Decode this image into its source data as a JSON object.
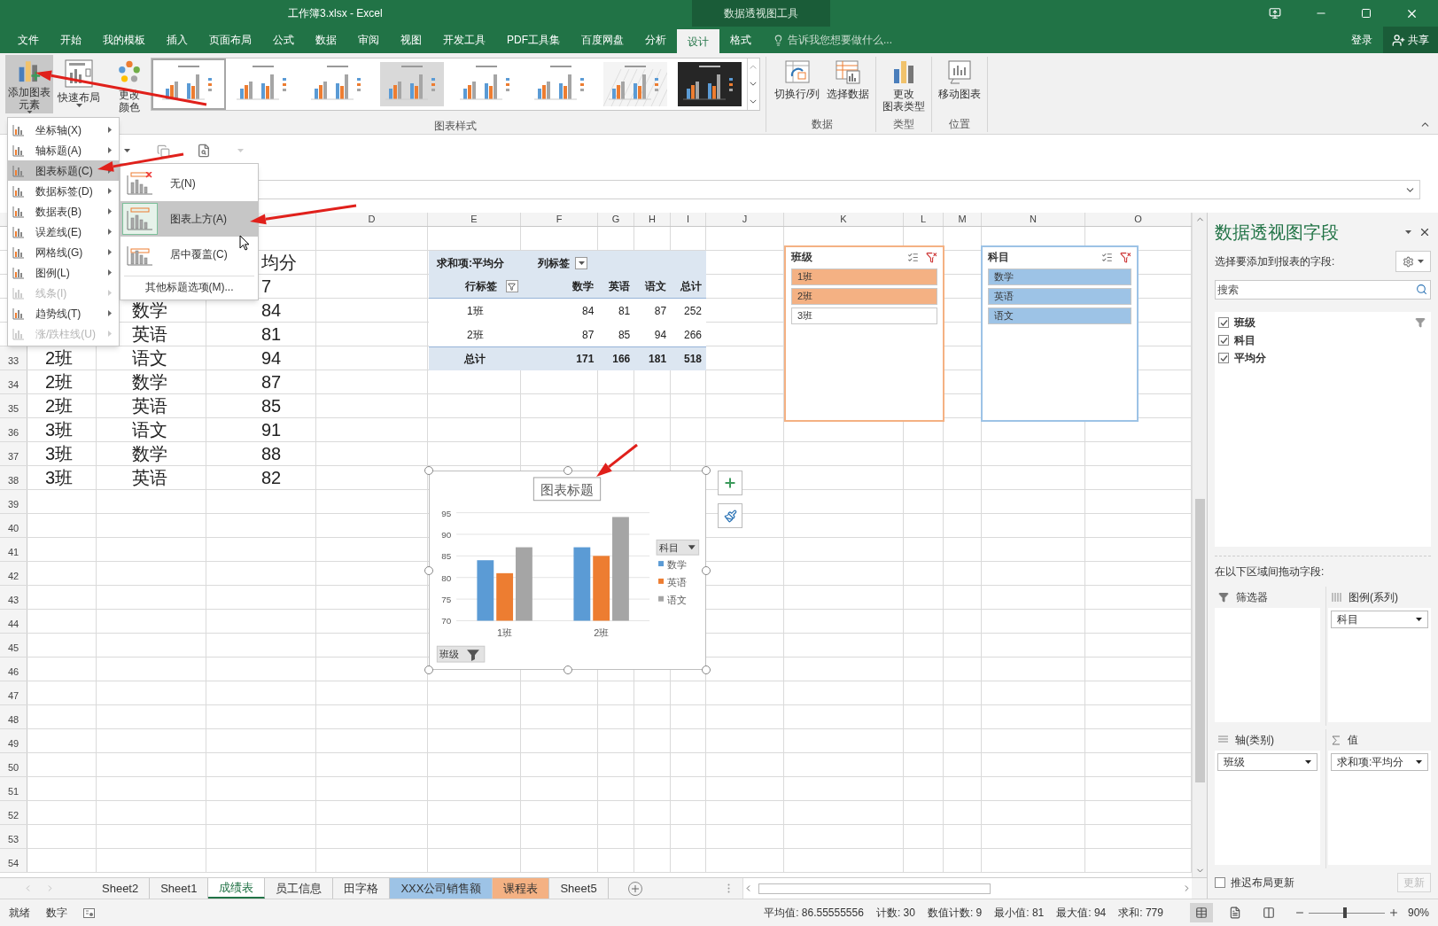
{
  "title_bar": {
    "title": "工作簿3.xlsx - Excel",
    "context_tab": "数据透视图工具"
  },
  "tabs": [
    {
      "label": "文件",
      "selected": false
    },
    {
      "label": "开始",
      "selected": false
    },
    {
      "label": "我的模板",
      "selected": false
    },
    {
      "label": "插入",
      "selected": false
    },
    {
      "label": "页面布局",
      "selected": false
    },
    {
      "label": "公式",
      "selected": false
    },
    {
      "label": "数据",
      "selected": false
    },
    {
      "label": "审阅",
      "selected": false
    },
    {
      "label": "视图",
      "selected": false
    },
    {
      "label": "开发工具",
      "selected": false
    },
    {
      "label": "PDF工具集",
      "selected": false
    },
    {
      "label": "百度网盘",
      "selected": false
    },
    {
      "label": "分析",
      "selected": false
    },
    {
      "label": "设计",
      "selected": true
    },
    {
      "label": "格式",
      "selected": false
    }
  ],
  "tell_me": {
    "placeholder": "告诉我您想要做什么..."
  },
  "account": {
    "sign_in": "登录",
    "share": "共享"
  },
  "ribbon": {
    "add_element": {
      "lines": [
        "添加图表",
        "元素"
      ],
      "pressed": true
    },
    "quick_layout": {
      "label": "快速布局"
    },
    "change_colors": {
      "lines": [
        "更改",
        "颜色"
      ]
    },
    "chart_styles": [
      {
        "kind": "light",
        "selected": true
      },
      {
        "kind": "light",
        "selected": false
      },
      {
        "kind": "light",
        "selected": false
      },
      {
        "kind": "gray",
        "selected": false
      },
      {
        "kind": "light",
        "selected": false
      },
      {
        "kind": "light",
        "selected": false
      },
      {
        "kind": "hatched",
        "selected": false
      },
      {
        "kind": "dark",
        "selected": false
      }
    ],
    "styles_group": "图表样式",
    "data_group": {
      "buttons": [
        "切换行/列",
        "选择数据"
      ],
      "label": "数据"
    },
    "type_group": {
      "button_lines": [
        "更改",
        "图表类型"
      ],
      "label": "类型"
    },
    "location_group": {
      "button": "移动图表",
      "label": "位置"
    }
  },
  "chart_element_menu": {
    "items": [
      {
        "label": "坐标轴(X)",
        "selected": false,
        "disabled": false
      },
      {
        "label": "轴标题(A)",
        "selected": false,
        "disabled": false
      },
      {
        "label": "图表标题(C)",
        "selected": true,
        "disabled": false
      },
      {
        "label": "数据标签(D)",
        "selected": false,
        "disabled": false
      },
      {
        "label": "数据表(B)",
        "selected": false,
        "disabled": false
      },
      {
        "label": "误差线(E)",
        "selected": false,
        "disabled": false
      },
      {
        "label": "网格线(G)",
        "selected": false,
        "disabled": false
      },
      {
        "label": "图例(L)",
        "selected": false,
        "disabled": false
      },
      {
        "label": "线条(I)",
        "selected": false,
        "disabled": true
      },
      {
        "label": "趋势线(T)",
        "selected": false,
        "disabled": false
      },
      {
        "label": "涨/跌柱线(U)",
        "selected": false,
        "disabled": true
      }
    ],
    "submenu": {
      "options": [
        {
          "label": "无(N)",
          "selected": false,
          "kind": "none"
        },
        {
          "label": "图表上方(A)",
          "selected": true,
          "kind": "above"
        },
        {
          "label": "居中覆盖(C)",
          "selected": false,
          "kind": "overlay"
        }
      ],
      "more": "其他标题选项(M)..."
    }
  },
  "sheet": {
    "column_headers": [
      "D",
      "E",
      "F",
      "G",
      "H",
      "I",
      "J",
      "K",
      "L",
      "M",
      "N",
      "O"
    ],
    "rows": [
      {
        "c": "均分"
      },
      {
        "c": "7"
      },
      {
        "b": "数学",
        "c": "84"
      },
      {
        "b": "英语",
        "c": "81"
      },
      {
        "number": "33",
        "a": "2班",
        "b": "语文",
        "c": "94"
      },
      {
        "number": "34",
        "a": "2班",
        "b": "数学",
        "c": "87"
      },
      {
        "number": "35",
        "a": "2班",
        "b": "英语",
        "c": "85"
      },
      {
        "number": "36",
        "a": "3班",
        "b": "语文",
        "c": "91"
      },
      {
        "number": "37",
        "a": "3班",
        "b": "数学",
        "c": "88"
      },
      {
        "number": "38",
        "a": "3班",
        "b": "英语",
        "c": "82"
      },
      {
        "number": "39"
      },
      {
        "number": "40"
      },
      {
        "number": "41"
      },
      {
        "number": "42"
      },
      {
        "number": "43"
      },
      {
        "number": "44"
      },
      {
        "number": "45"
      },
      {
        "number": "46"
      },
      {
        "number": "47"
      },
      {
        "number": "48"
      },
      {
        "number": "49"
      },
      {
        "number": "50"
      },
      {
        "number": "51"
      },
      {
        "number": "52"
      },
      {
        "number": "53"
      },
      {
        "number": "54"
      }
    ]
  },
  "pivot": {
    "value_label": "求和项:平均分",
    "column_labels": "列标签",
    "row_labels": "行标签",
    "columns": [
      "数学",
      "英语",
      "语文",
      "总计"
    ],
    "rows": [
      {
        "label": "1班",
        "values": [
          "84",
          "81",
          "87",
          "252"
        ]
      },
      {
        "label": "2班",
        "values": [
          "87",
          "85",
          "94",
          "266"
        ]
      }
    ],
    "total": {
      "label": "总计",
      "values": [
        "171",
        "166",
        "181",
        "518"
      ]
    }
  },
  "slicers": [
    {
      "title": "班级",
      "color": "#f4b183",
      "items": [
        {
          "label": "1班",
          "selected": true
        },
        {
          "label": "2班",
          "selected": true
        },
        {
          "label": "3班",
          "selected": false
        }
      ]
    },
    {
      "title": "科目",
      "color": "#9dc3e6",
      "items": [
        {
          "label": "数学",
          "selected": true
        },
        {
          "label": "英语",
          "selected": true
        },
        {
          "label": "语文",
          "selected": true
        }
      ]
    }
  ],
  "chart": {
    "legend_field": "科目",
    "axis_field": "班级",
    "chart_data": {
      "type": "bar",
      "title": "图表标题",
      "categories": [
        "1班",
        "2班"
      ],
      "series": [
        {
          "name": "数学",
          "color": "#5b9bd5",
          "values": [
            84,
            87
          ]
        },
        {
          "name": "英语",
          "color": "#ed7d31",
          "values": [
            81,
            85
          ]
        },
        {
          "name": "语文",
          "color": "#a5a5a5",
          "values": [
            87,
            94
          ]
        }
      ],
      "ylim": [
        70,
        95
      ],
      "yticks": [
        70,
        75,
        80,
        85,
        90,
        95
      ],
      "grid": true,
      "legend": true
    }
  },
  "field_pane": {
    "title": "数据透视图字段",
    "subtitle": "选择要添加到报表的字段:",
    "search_placeholder": "搜索",
    "fields": [
      {
        "label": "班级",
        "checked": true,
        "filtered": true
      },
      {
        "label": "科目",
        "checked": true,
        "filtered": false
      },
      {
        "label": "平均分",
        "checked": true,
        "filtered": false
      }
    ],
    "areas_hint": "在以下区域间拖动字段:",
    "areas": [
      {
        "kind": "filter",
        "title": "筛选器"
      },
      {
        "kind": "legend",
        "title": "图例(系列)",
        "fields": [
          "科目"
        ]
      },
      {
        "kind": "axis",
        "title": "轴(类别)",
        "fields": [
          "班级"
        ]
      },
      {
        "kind": "values",
        "title": "值",
        "fields": [
          "求和项:平均分"
        ]
      }
    ],
    "defer": {
      "label": "推迟布局更新",
      "checked": false
    },
    "update_button": {
      "label": "更新",
      "disabled": true
    }
  },
  "sheet_tabs": [
    {
      "label": "Sheet2",
      "selected": false
    },
    {
      "label": "Sheet1",
      "selected": false
    },
    {
      "label": "成绩表",
      "selected": true
    },
    {
      "label": "员工信息",
      "selected": false
    },
    {
      "label": "田字格",
      "selected": false
    },
    {
      "label": "XXX公司销售额",
      "selected": false,
      "color": "#9dc3e6"
    },
    {
      "label": "课程表",
      "selected": false,
      "color": "#f4b183"
    },
    {
      "label": "Sheet5",
      "selected": false
    }
  ],
  "status_bar": {
    "left": [
      "就绪",
      "数字"
    ],
    "stats": [
      "平均值: 86.55555556",
      "计数: 30",
      "数值计数: 9",
      "最小值: 81",
      "最大值: 94",
      "求和: 779"
    ],
    "views": [
      {
        "selected": true
      },
      {
        "selected": false
      },
      {
        "selected": false
      }
    ],
    "zoom": {
      "level": 0.45,
      "label": "90%"
    }
  }
}
